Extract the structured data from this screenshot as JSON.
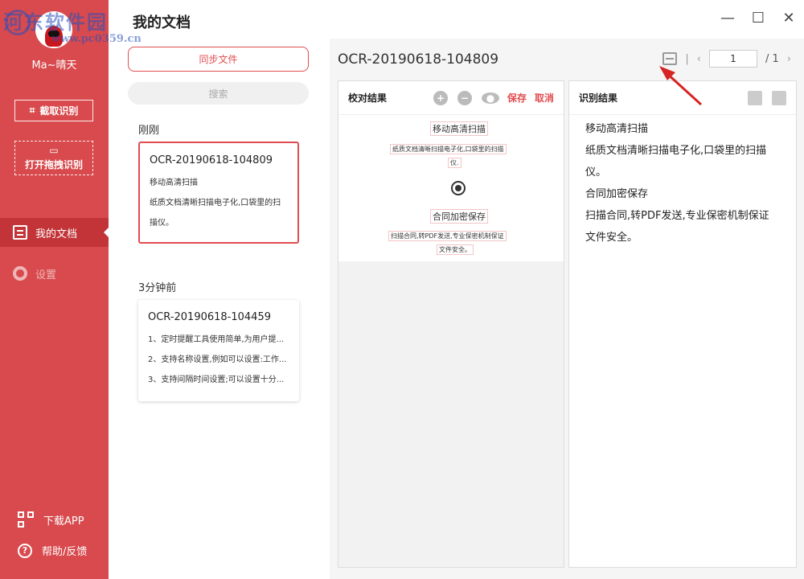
{
  "window": {
    "title": "我的文档",
    "controls": [
      "—",
      "☐",
      "✕"
    ]
  },
  "watermark": {
    "line1": "河东软件园",
    "line2": "www.pc0359.cn"
  },
  "sidebar": {
    "username": "Ma~晴天",
    "crop_button": "截取识别",
    "open_button": "打开拖拽识别",
    "nav": [
      {
        "label": "我的文档",
        "icon": "document-icon",
        "active": true
      },
      {
        "label": "设置",
        "icon": "gear-icon",
        "active": false
      }
    ],
    "download": "下载APP",
    "help": "帮助/反馈"
  },
  "doclist": {
    "sync_button": "同步文件",
    "search_placeholder": "搜索",
    "groups": [
      {
        "label": "刚刚",
        "card": {
          "title": "OCR-20190618-104809",
          "lines": [
            "移动高清扫描",
            "纸质文档清晰扫描电子化,口袋里的扫描仪。"
          ]
        }
      },
      {
        "label": "3分钟前",
        "card": {
          "title": "OCR-20190618-104459",
          "lines": [
            "1、定时提醒工具使用简单,为用户提...",
            "2、支持名称设置,例如可以设置:工作...",
            "3、支持间隔时间设置;可以设置十分..."
          ]
        }
      }
    ]
  },
  "viewer": {
    "doc_name": "OCR-20190618-104809",
    "page_current": "1",
    "page_total": "/ 1",
    "proof_panel": {
      "title": "校对结果",
      "save": "保存",
      "cancel": "取消",
      "snippets": [
        "移动高清扫描",
        "纸质文档清晰扫描电子化,口袋里的扫描",
        "仪.",
        "合同加密保存",
        "扫描合同,转PDF发送,专业保密机制保证",
        "文件安全。"
      ]
    },
    "result_panel": {
      "title": "识别结果",
      "lines": [
        "移动高清扫描",
        "纸质文档清晰扫描电子化,口袋里的扫描",
        "仪。",
        "合同加密保存",
        "扫描合同,转PDF发送,专业保密机制保证",
        "文件安全。"
      ]
    }
  },
  "colors": {
    "sidebar": "#d84a4d",
    "accent": "#e24c50",
    "nav_active": "#c23437"
  }
}
